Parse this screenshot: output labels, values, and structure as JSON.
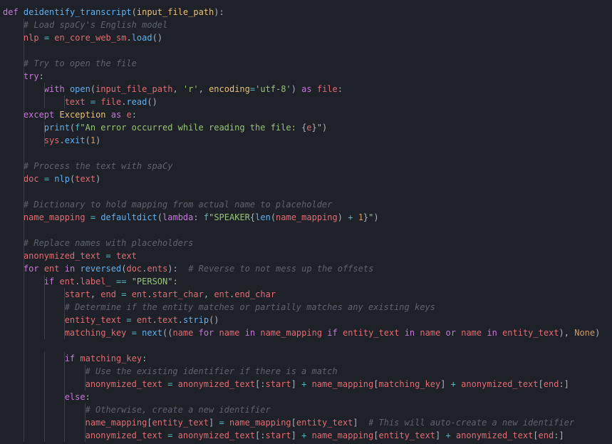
{
  "code": {
    "lines": [
      {
        "indent": 0,
        "html": "<span class='kw'>def</span> <span class='fname'>deidentify_transcript</span><span class='pn'>(</span><span class='param'>input_file_path</span><span class='pn'>):</span>"
      },
      {
        "indent": 1,
        "html": "<span class='cmt'># Load spaCy's English model</span>"
      },
      {
        "indent": 1,
        "html": "<span class='var'>nlp</span> <span class='op'>=</span> <span class='var'>en_core_web_sm</span><span class='pn'>.</span><span class='fn'>load</span><span class='pn'>()</span>"
      },
      {
        "indent": 0,
        "html": ""
      },
      {
        "indent": 1,
        "html": "<span class='cmt'># Try to open the file</span>"
      },
      {
        "indent": 1,
        "html": "<span class='kw'>try</span><span class='pn'>:</span>"
      },
      {
        "indent": 2,
        "html": "<span class='kw'>with</span> <span class='fn'>open</span><span class='pn'>(</span><span class='var'>input_file_path</span><span class='pn'>,</span> <span class='str'>'r'</span><span class='pn'>,</span> <span class='param'>encoding</span><span class='op'>=</span><span class='str'>'utf-8'</span><span class='pn'>)</span> <span class='kw'>as</span> <span class='var'>file</span><span class='pn'>:</span>"
      },
      {
        "indent": 3,
        "html": "<span class='var'>text</span> <span class='op'>=</span> <span class='var'>file</span><span class='pn'>.</span><span class='fn'>read</span><span class='pn'>()</span>"
      },
      {
        "indent": 1,
        "html": "<span class='kw'>except</span> <span class='builtin'>Exception</span> <span class='kw'>as</span> <span class='var'>e</span><span class='pn'>:</span>"
      },
      {
        "indent": 2,
        "html": "<span class='fn'>print</span><span class='pn'>(</span><span class='op'>f</span><span class='str'>\"An error occurred while reading the file: </span><span class='pn'>{</span><span class='var'>e</span><span class='pn'>}</span><span class='str'>\"</span><span class='pn'>)</span>"
      },
      {
        "indent": 2,
        "html": "<span class='var'>sys</span><span class='pn'>.</span><span class='fn'>exit</span><span class='pn'>(</span><span class='num'>1</span><span class='pn'>)</span>"
      },
      {
        "indent": 0,
        "html": ""
      },
      {
        "indent": 1,
        "html": "<span class='cmt'># Process the text with spaCy</span>"
      },
      {
        "indent": 1,
        "html": "<span class='var'>doc</span> <span class='op'>=</span> <span class='fn'>nlp</span><span class='pn'>(</span><span class='var'>text</span><span class='pn'>)</span>"
      },
      {
        "indent": 0,
        "html": ""
      },
      {
        "indent": 1,
        "html": "<span class='cmt'># Dictionary to hold mapping from actual name to placeholder</span>"
      },
      {
        "indent": 1,
        "html": "<span class='var'>name_mapping</span> <span class='op'>=</span> <span class='fn'>defaultdict</span><span class='pn'>(</span><span class='kw'>lambda</span><span class='pn'>:</span> <span class='op'>f</span><span class='str'>\"SPEAKER</span><span class='pn'>{</span><span class='fn'>len</span><span class='pn'>(</span><span class='var'>name_mapping</span><span class='pn'>)</span> <span class='op'>+</span> <span class='num'>1</span><span class='pn'>}</span><span class='str'>\"</span><span class='pn'>)</span>"
      },
      {
        "indent": 0,
        "html": ""
      },
      {
        "indent": 1,
        "html": "<span class='cmt'># Replace names with placeholders</span>"
      },
      {
        "indent": 1,
        "html": "<span class='var'>anonymized_text</span> <span class='op'>=</span> <span class='var'>text</span>"
      },
      {
        "indent": 1,
        "html": "<span class='kw'>for</span> <span class='var'>ent</span> <span class='kw'>in</span> <span class='fn'>reversed</span><span class='pn'>(</span><span class='var'>doc</span><span class='pn'>.</span><span class='prop'>ents</span><span class='pn'>):</span>  <span class='cmt'># Reverse to not mess up the offsets</span>"
      },
      {
        "indent": 2,
        "html": "<span class='kw'>if</span> <span class='var'>ent</span><span class='pn'>.</span><span class='prop'>label_</span> <span class='op'>==</span> <span class='str'>\"PERSON\"</span><span class='pn'>:</span>"
      },
      {
        "indent": 3,
        "html": "<span class='var'>start</span><span class='pn'>,</span> <span class='var'>end</span> <span class='op'>=</span> <span class='var'>ent</span><span class='pn'>.</span><span class='prop'>start_char</span><span class='pn'>,</span> <span class='var'>ent</span><span class='pn'>.</span><span class='prop'>end_char</span>"
      },
      {
        "indent": 3,
        "html": "<span class='cmt'># Determine if the entity matches or partially matches any existing keys</span>"
      },
      {
        "indent": 3,
        "html": "<span class='var'>entity_text</span> <span class='op'>=</span> <span class='var'>ent</span><span class='pn'>.</span><span class='prop'>text</span><span class='pn'>.</span><span class='fn'>strip</span><span class='pn'>()</span>"
      },
      {
        "indent": 3,
        "html": "<span class='var'>matching_key</span> <span class='op'>=</span> <span class='fn'>next</span><span class='pn'>((</span><span class='var'>name</span> <span class='kw'>for</span> <span class='var'>name</span> <span class='kw'>in</span> <span class='var'>name_mapping</span> <span class='kw'>if</span> <span class='var'>entity_text</span> <span class='kw'>in</span> <span class='var'>name</span> <span class='kw'>or</span> <span class='var'>name</span> <span class='kw'>in</span> <span class='var'>entity_text</span><span class='pn'>),</span> <span class='const'>None</span><span class='pn'>)</span>"
      },
      {
        "indent": 0,
        "html": ""
      },
      {
        "indent": 3,
        "html": "<span class='kw'>if</span> <span class='var'>matching_key</span><span class='pn'>:</span>"
      },
      {
        "indent": 4,
        "html": "<span class='cmt'># Use the existing identifier if there is a match</span>"
      },
      {
        "indent": 4,
        "html": "<span class='var'>anonymized_text</span> <span class='op'>=</span> <span class='var'>anonymized_text</span><span class='pn'>[:</span><span class='var'>start</span><span class='pn'>]</span> <span class='op'>+</span> <span class='var'>name_mapping</span><span class='pn'>[</span><span class='var'>matching_key</span><span class='pn'>]</span> <span class='op'>+</span> <span class='var'>anonymized_text</span><span class='pn'>[</span><span class='var'>end</span><span class='pn'>:]</span>"
      },
      {
        "indent": 3,
        "html": "<span class='kw'>else</span><span class='pn'>:</span>"
      },
      {
        "indent": 4,
        "html": "<span class='cmt'># Otherwise, create a new identifier</span>"
      },
      {
        "indent": 4,
        "html": "<span class='var'>name_mapping</span><span class='pn'>[</span><span class='var'>entity_text</span><span class='pn'>]</span> <span class='op'>=</span> <span class='var'>name_mapping</span><span class='pn'>[</span><span class='var'>entity_text</span><span class='pn'>]</span>  <span class='cmt'># This will auto-create a new identifier</span>"
      },
      {
        "indent": 4,
        "html": "<span class='var'>anonymized_text</span> <span class='op'>=</span> <span class='var'>anonymized_text</span><span class='pn'>[:</span><span class='var'>start</span><span class='pn'>]</span> <span class='op'>+</span> <span class='var'>name_mapping</span><span class='pn'>[</span><span class='var'>entity_text</span><span class='pn'>]</span> <span class='op'>+</span> <span class='var'>anonymized_text</span><span class='pn'>[</span><span class='var'>end</span><span class='pn'>:]</span>"
      }
    ]
  },
  "theme": {
    "bg": "#1e2127",
    "indent_guide": "#3a3f4b"
  }
}
